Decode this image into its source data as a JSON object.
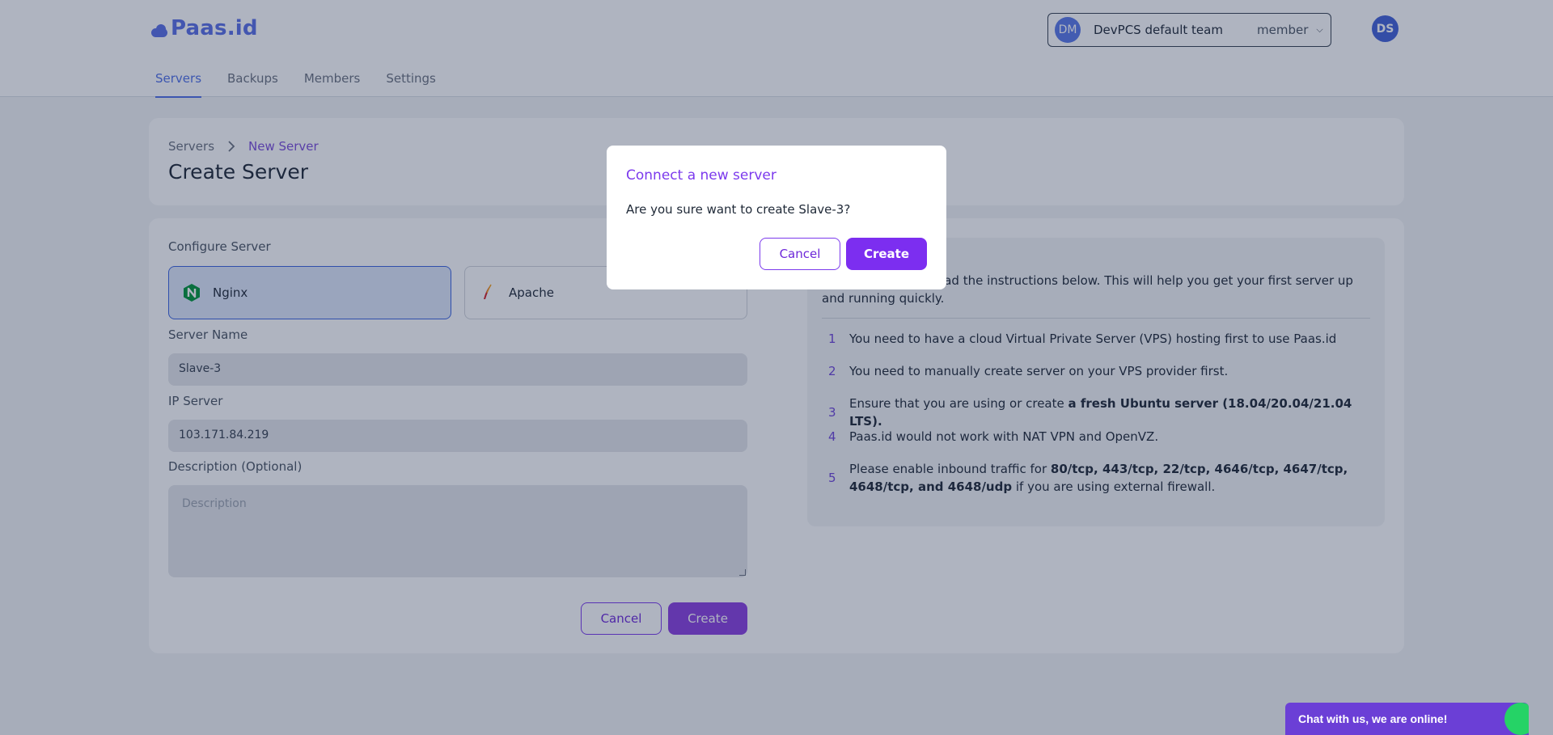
{
  "header": {
    "logo_text": "Paas.id",
    "team": {
      "avatar": "DM",
      "name": "DevPCS default team",
      "role": "member"
    },
    "user_avatar": "DS",
    "nav": [
      "Servers",
      "Backups",
      "Members",
      "Settings"
    ],
    "active_nav": "Servers"
  },
  "breadcrumb": {
    "parent": "Servers",
    "current": "New Server"
  },
  "page_title": "Create Server",
  "form": {
    "configure_label": "Configure Server",
    "options": [
      {
        "label": "Nginx",
        "selected": true,
        "icon": "nginx-icon"
      },
      {
        "label": "Apache",
        "selected": false,
        "icon": "apache-feather-icon"
      }
    ],
    "server_name_label": "Server Name",
    "server_name_value": "Slave-3",
    "ip_label": "IP Server",
    "ip_value": "103.171.84.219",
    "description_label": "Description (Optional)",
    "description_placeholder": "Description",
    "cancel_label": "Cancel",
    "create_label": "Create"
  },
  "info": {
    "intro": "ave some time to read the instructions below. This will help you get your first server up and running quickly.",
    "steps": [
      {
        "num": "1",
        "text": "You need to have a cloud Virtual Private Server (VPS) hosting first to use Paas.id"
      },
      {
        "num": "2",
        "text": "You need to manually create server on your VPS provider first."
      },
      {
        "num": "3",
        "text_pre": "Ensure that you are using or create ",
        "text_bold": "a fresh Ubuntu server",
        "text_post": " (18.04/20.04/21.04 LTS)."
      },
      {
        "num": "4",
        "text": "Paas.id would not work with NAT VPN and OpenVZ."
      },
      {
        "num": "5",
        "text_pre": "Please enable inbound traffic for ",
        "text_bold": "80/tcp, 443/tcp, 22/tcp, 4646/tcp, 4647/tcp, 4648/tcp, and 4648/udp",
        "text_post": " if you are using external firewall."
      }
    ]
  },
  "modal": {
    "title": "Connect a new server",
    "message": "Are you sure want to create Slave-3?",
    "cancel_label": "Cancel",
    "create_label": "Create"
  },
  "chat": {
    "label": "Chat with us, we are online!"
  },
  "colors": {
    "brand": "#5a6fe6",
    "accent": "#7c3aed",
    "chat": "#6b3fd6"
  }
}
